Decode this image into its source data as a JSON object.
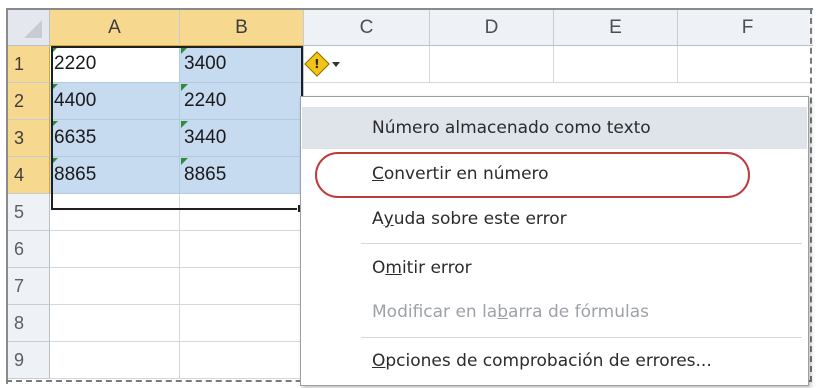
{
  "columns": [
    "A",
    "B",
    "C",
    "D",
    "E",
    "F"
  ],
  "rows": [
    "1",
    "2",
    "3",
    "4",
    "5",
    "6",
    "7",
    "8",
    "9"
  ],
  "cells": {
    "A": [
      "2220",
      "4400",
      "6635",
      "8865"
    ],
    "B": [
      "3400",
      "2240",
      "3440",
      "8865"
    ]
  },
  "menu": {
    "header": "Número almacenado como texto",
    "convert_pre": "",
    "convert_u": "C",
    "convert_post": "onvertir en número",
    "help_pre": "A",
    "help_u": "y",
    "help_post": "uda sobre este error",
    "ignore_pre": "O",
    "ignore_u": "m",
    "ignore_post": "itir error",
    "edit_pre": "Modificar en la ",
    "edit_u": "b",
    "edit_post": "arra de fórmulas",
    "options_pre": "",
    "options_u": "O",
    "options_post": "pciones de comprobación de errores..."
  },
  "colors": {
    "selection": "#c6daf0",
    "header_selected": "#f6d88f",
    "highlight": "#c0393b",
    "warning": "#f2c418"
  },
  "icons": {
    "smart_tag": "warning-icon",
    "dropdown": "chevron-down-icon"
  }
}
